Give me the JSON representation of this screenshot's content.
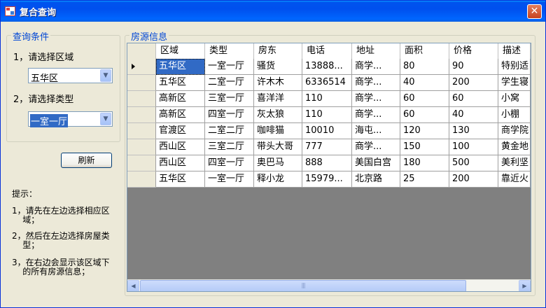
{
  "window": {
    "title": "复合查询",
    "close_glyph": "✕"
  },
  "criteria": {
    "legend": "查询条件",
    "region_label": "1，请选择区域",
    "region_value": "五华区",
    "type_label": "2，请选择类型",
    "type_value": "一室一厅"
  },
  "refresh_button": "刷新",
  "tips": {
    "title": "提示：",
    "items": [
      "1，请先在左边选择相应区\n    域；",
      "2，然后在左边选择房屋类\n    型；",
      "3，在右边会显示该区域下\n    的所有房源信息；"
    ]
  },
  "listing": {
    "legend": "房源信息",
    "columns": [
      "区域",
      "类型",
      "房东",
      "电话",
      "地址",
      "面积",
      "价格",
      "描述"
    ],
    "rows": [
      [
        "五华区",
        "一室一厅",
        "骚货",
        "13888...",
        "商学...",
        "80",
        "90",
        "特别适"
      ],
      [
        "五华区",
        "二室一厅",
        "许木木",
        "6336514",
        "商学...",
        "40",
        "200",
        "学生寝"
      ],
      [
        "高新区",
        "三室一厅",
        "喜洋洋",
        "110",
        "商学...",
        "60",
        "60",
        "小窝"
      ],
      [
        "高新区",
        "四室一厅",
        "灰太狼",
        "110",
        "商学...",
        "60",
        "40",
        "小棚"
      ],
      [
        "官渡区",
        "二室二厅",
        "咖啡猫",
        "10010",
        "海屯...",
        "120",
        "130",
        "商学院"
      ],
      [
        "西山区",
        "三室二厅",
        "带头大哥",
        "777",
        "商学...",
        "150",
        "100",
        "黄金地"
      ],
      [
        "西山区",
        "四室一厅",
        "奥巴马",
        "888",
        "美国白宫",
        "180",
        "500",
        "美利坚"
      ],
      [
        "五华区",
        "一室一厅",
        "释小龙",
        "15979...",
        "北京路",
        "25",
        "200",
        "靠近火"
      ]
    ]
  },
  "scrollbar": {
    "left_glyph": "◀",
    "right_glyph": "▶",
    "grip": "|||"
  }
}
